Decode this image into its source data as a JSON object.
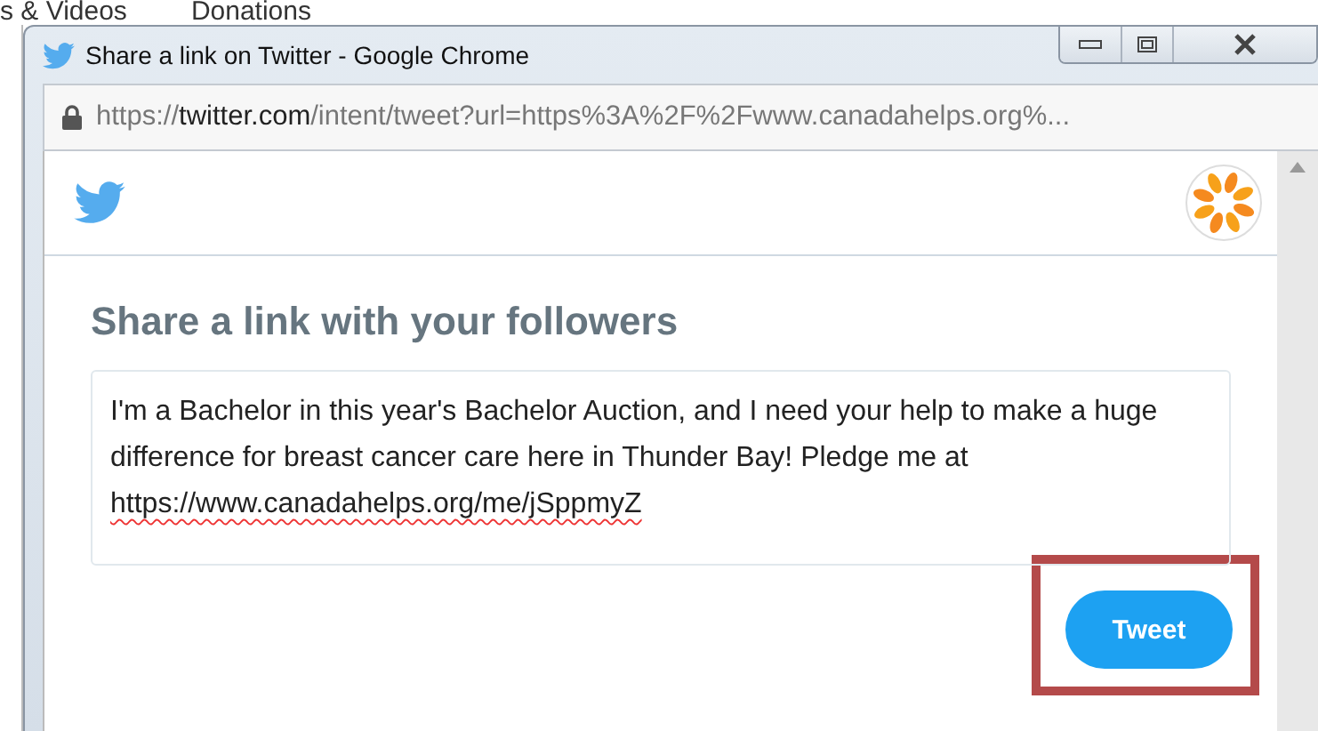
{
  "background_nav": [
    "s & Videos",
    "Donations"
  ],
  "window": {
    "title": "Share a link on Twitter - Google Chrome"
  },
  "address_bar": {
    "scheme": "https://",
    "host": "twitter.com",
    "path": "/intent/tweet?url=https%3A%2F%2Fwww.canadahelps.org%..."
  },
  "heading": "Share a link with your followers",
  "tweet_box": {
    "value": "I'm a Bachelor in this year's Bachelor Auction, and I need your help to make a huge difference for breast cancer care here in Thunder Bay! Pledge me at",
    "link": "https://www.canadahelps.org/me/jSppmyZ"
  },
  "tweet_button": {
    "label": "Tweet",
    "highlighted": true
  }
}
